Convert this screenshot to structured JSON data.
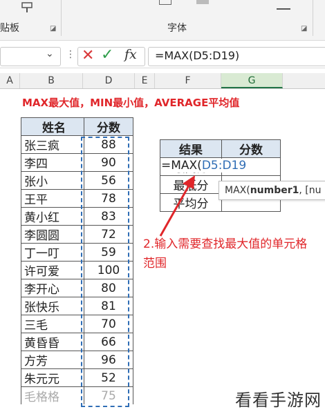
{
  "ribbon": {
    "clipboard_label": "剪贴板",
    "font_label": "字体"
  },
  "formula_bar": {
    "name_box_value": "",
    "formula": "=MAX(D5:D19)"
  },
  "column_headers": [
    "A",
    "B",
    "D",
    "E",
    "F",
    "G"
  ],
  "title": "MAX最大值，MIN最小值，AVERAGE平均值",
  "main_table": {
    "headers": [
      "姓名",
      "分数"
    ],
    "rows": [
      {
        "name": "张三疯",
        "score": "88"
      },
      {
        "name": "李四",
        "score": "90"
      },
      {
        "name": "张小",
        "score": "56"
      },
      {
        "name": "王平",
        "score": "78"
      },
      {
        "name": "黄小红",
        "score": "83"
      },
      {
        "name": "李圆圆",
        "score": "72"
      },
      {
        "name": "丁一叮",
        "score": "59"
      },
      {
        "name": "许可爱",
        "score": "100"
      },
      {
        "name": "李开心",
        "score": "80"
      },
      {
        "name": "张快乐",
        "score": "81"
      },
      {
        "name": "三毛",
        "score": "70"
      },
      {
        "name": "黄昏昏",
        "score": "66"
      },
      {
        "name": "方芳",
        "score": "96"
      },
      {
        "name": "朱元元",
        "score": "52"
      },
      {
        "name": "毛格格",
        "score": "75"
      }
    ]
  },
  "result_table": {
    "headers": [
      "结果",
      "分数"
    ],
    "row_labels": [
      "最高分",
      "最低分",
      "平均分"
    ],
    "editing_formula_prefix": "=MAX(",
    "editing_formula_ref": "D5:D19"
  },
  "tooltip": {
    "func": "MAX(",
    "arg": "number1",
    "rest": ", [nu"
  },
  "annotation": "2.输入需要查找最大值的单元格范围",
  "watermark": "看看手游网",
  "colors": {
    "accent_red": "#e0262a",
    "header_fill": "#dce6f1",
    "selection_green": "#217346",
    "ref_blue": "#2f6db5"
  }
}
